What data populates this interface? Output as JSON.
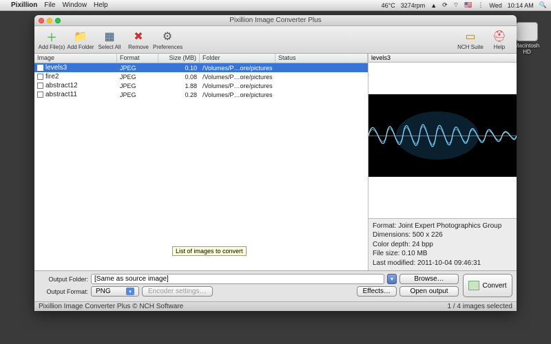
{
  "menubar": {
    "app": "Pixillion",
    "items": [
      "File",
      "Window",
      "Help"
    ],
    "temp": "46°C",
    "rpm": "3274rpm",
    "day": "Wed",
    "time": "10:14 AM"
  },
  "desktop": {
    "hd_label": "Macintosh HD"
  },
  "window": {
    "title": "Pixillion Image Converter Plus"
  },
  "toolbar": {
    "add_files": "Add File(s)",
    "add_folder": "Add Folder",
    "select_all": "Select All",
    "remove": "Remove",
    "preferences": "Preferences",
    "nch_suite": "NCH Suite",
    "help": "Help"
  },
  "columns": {
    "image": "Image",
    "format": "Format",
    "size": "Size (MB)",
    "folder": "Folder",
    "status": "Status"
  },
  "files": [
    {
      "name": "levels3",
      "format": "JPEG",
      "size": "0.10",
      "folder": "/Volumes/P…ore/pictures",
      "selected": true
    },
    {
      "name": "fire2",
      "format": "JPEG",
      "size": "0.08",
      "folder": "/Volumes/P…ore/pictures",
      "selected": false
    },
    {
      "name": "abstract12",
      "format": "JPEG",
      "size": "1.88",
      "folder": "/Volumes/P…ore/pictures",
      "selected": false
    },
    {
      "name": "abstract11",
      "format": "JPEG",
      "size": "0.28",
      "folder": "/Volumes/P…ore/pictures",
      "selected": false
    }
  ],
  "preview": {
    "name": "levels3",
    "meta": {
      "format": "Format: Joint Expert Photographics Group",
      "dimensions": "Dimensions: 500 x 226",
      "depth": "Color depth: 24 bpp",
      "filesize": "File size: 0.10 MB",
      "modified": "Last modified: 2011-10-04 09:46:31"
    }
  },
  "tooltip": "List of images to convert",
  "output": {
    "folder_label": "Output Folder:",
    "folder_value": "[Same as source image]",
    "format_label": "Output Format:",
    "format_value": "PNG",
    "encoder": "Encoder settings…",
    "browse": "Browse…",
    "open": "Open output",
    "effects": "Effects…",
    "convert": "Convert"
  },
  "status": {
    "left": "Pixillion Image Converter Plus  © NCH Software",
    "right": "1 / 4 images selected"
  }
}
